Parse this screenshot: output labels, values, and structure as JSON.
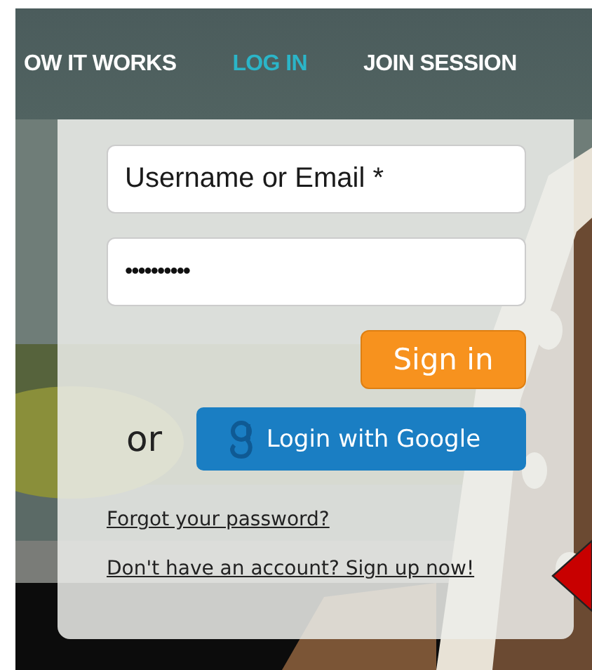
{
  "nav": {
    "items": [
      {
        "label": "OW IT WORKS",
        "selected": false
      },
      {
        "label": "LOG IN",
        "selected": true
      },
      {
        "label": "JOIN SESSION",
        "selected": false
      }
    ]
  },
  "login": {
    "username": {
      "placeholder": "Username or Email *"
    },
    "password": {
      "value": "••••••••••"
    },
    "sign_in": "Sign in",
    "or": "or",
    "google": "Login with Google",
    "links": [
      "Forgot your password?",
      "Don't have an account? Sign up now!"
    ]
  }
}
